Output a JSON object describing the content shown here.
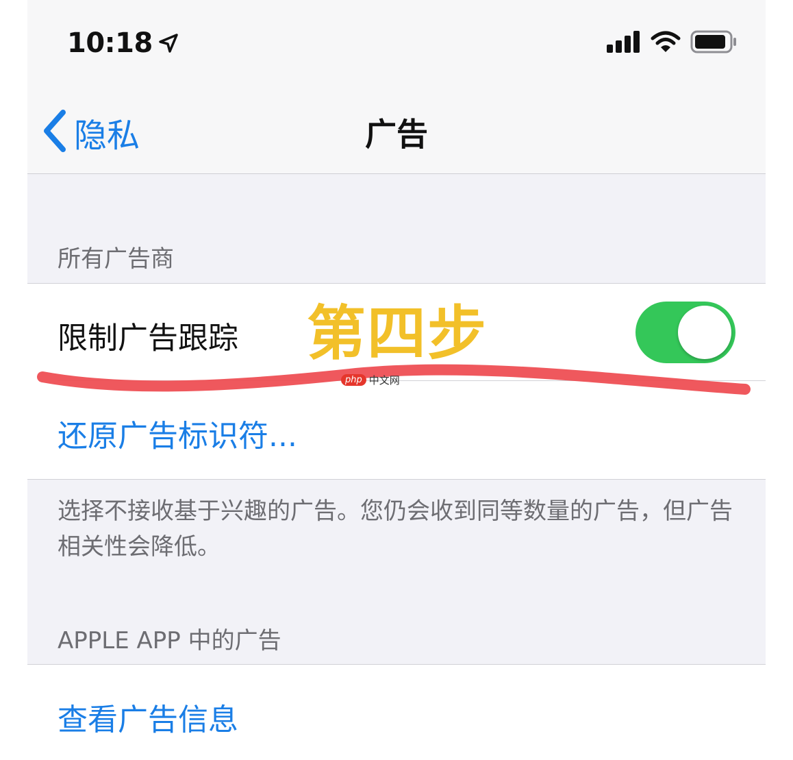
{
  "status_bar": {
    "time": "10:18",
    "icons": [
      "location-arrow-icon",
      "cellular-signal-icon",
      "wifi-icon",
      "battery-icon"
    ]
  },
  "nav": {
    "back_label": "隐私",
    "title": "广告"
  },
  "sections": {
    "all_advertisers_header": "所有广告商",
    "limit_ad_tracking_label": "限制广告跟踪",
    "limit_ad_tracking_on": true,
    "reset_identifier_label": "还原广告标识符...",
    "footer_text": "选择不接收基于兴趣的广告。您仍会收到同等数量的广告，但广告相关性会降低。",
    "apple_ads_header": "APPLE APP 中的广告",
    "view_ad_info_label": "查看广告信息"
  },
  "annotation": {
    "step_text": "第四步",
    "step_color": "#f2c029",
    "underline_color": "#ee4a4f"
  },
  "watermark": {
    "logo": "php",
    "text": "中文网"
  },
  "colors": {
    "accent_blue": "#1a7ee6",
    "toggle_green": "#34c759",
    "grouped_background": "#f2f2f7"
  }
}
